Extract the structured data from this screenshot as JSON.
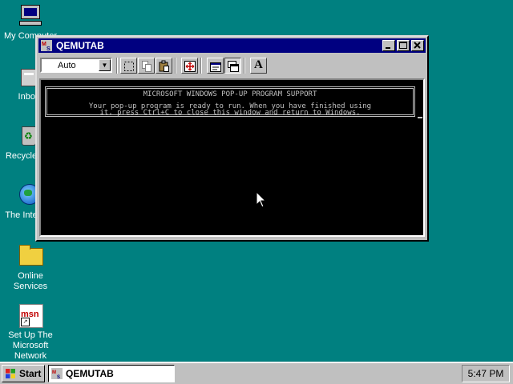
{
  "desktop": {
    "icons": [
      {
        "label": "My Computer"
      },
      {
        "label": "Inbox"
      },
      {
        "label": "Recycle Bin"
      },
      {
        "label": "The Internet"
      },
      {
        "label": "Online Services"
      },
      {
        "label": "Set Up The Microsoft Network"
      }
    ]
  },
  "window": {
    "title": "QEMUTAB",
    "font_size": "Auto",
    "console": {
      "heading": "MICROSOFT WINDOWS POP-UP PROGRAM SUPPORT",
      "line1": "Your pop-up program is ready to run. When you have finished using",
      "line2": "it, press Ctrl+C to close this window and return to Windows."
    },
    "toolbar_icons": [
      "mark-icon",
      "copy-icon",
      "paste-icon",
      "fullscreen-icon",
      "properties-icon",
      "background-icon",
      "font-icon"
    ]
  },
  "taskbar": {
    "start_label": "Start",
    "task_label": "QEMUTAB",
    "clock": "5:47 PM"
  },
  "colors": {
    "desktop": "#008080",
    "titlebar": "#000080",
    "face": "#c0c0c0"
  }
}
